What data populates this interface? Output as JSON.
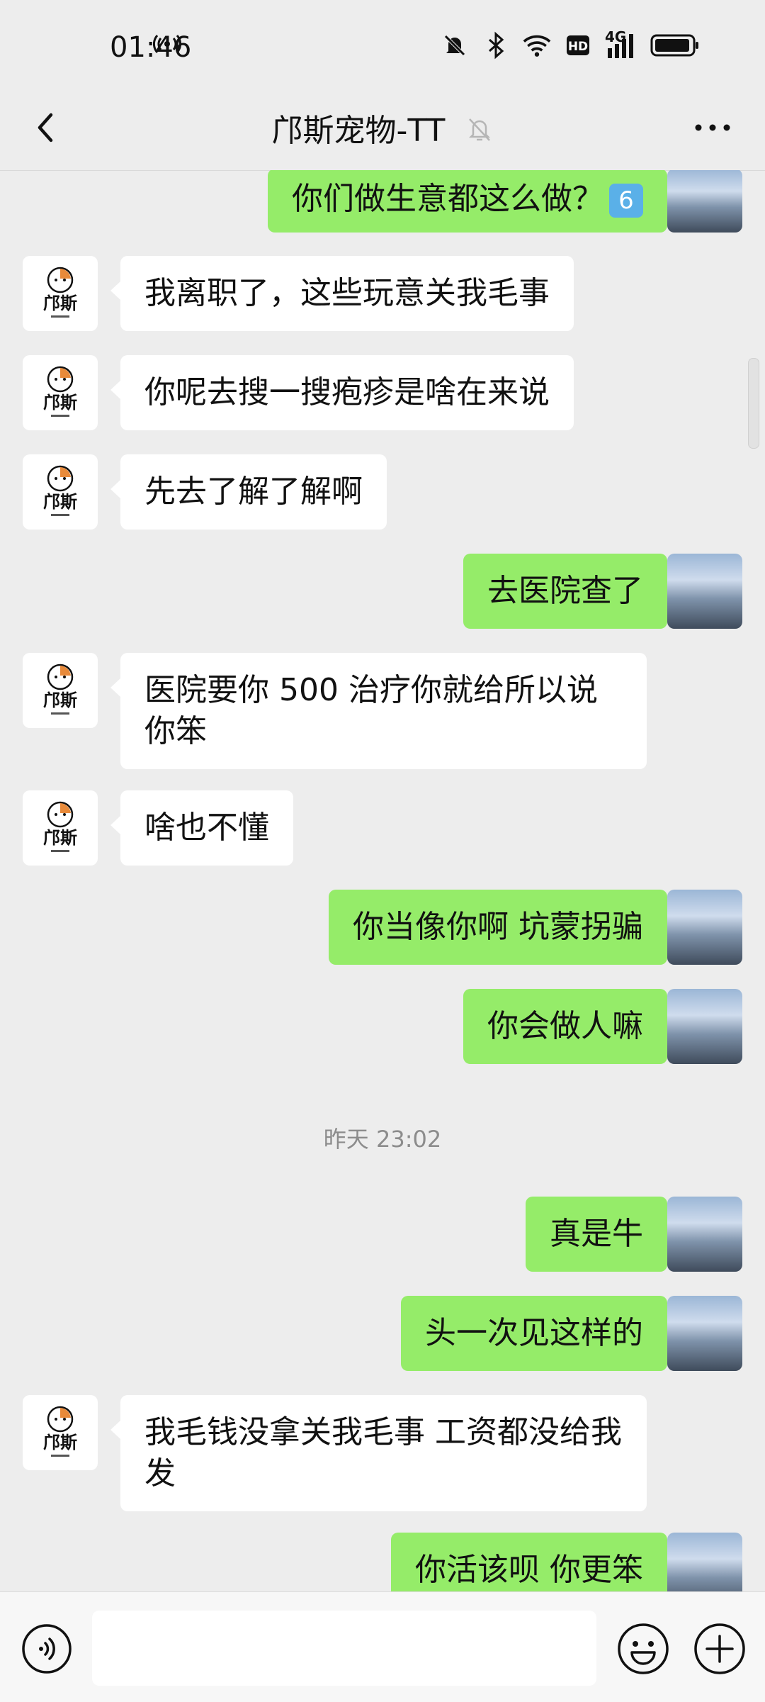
{
  "status": {
    "time": "01:46",
    "network": "4G"
  },
  "header": {
    "title": "邝斯宠物-TT"
  },
  "contact_logo_text": "邝斯",
  "messages": [
    {
      "side": "right",
      "text": "你们做生意都这么做？",
      "emoji": "6"
    },
    {
      "side": "left",
      "text": "我离职了，这些玩意关我毛事"
    },
    {
      "side": "left",
      "text": "你呢去搜一搜疱疹是啥在来说"
    },
    {
      "side": "left",
      "text": "先去了解了解啊"
    },
    {
      "side": "right",
      "text": "去医院查了"
    },
    {
      "side": "left",
      "text": "医院要你 500 治疗你就给所以说你笨"
    },
    {
      "side": "left",
      "text": "啥也不懂"
    },
    {
      "side": "right",
      "text": "你当像你啊 坑蒙拐骗"
    },
    {
      "side": "right",
      "text": "你会做人嘛"
    },
    {
      "side": "right",
      "text": "真是牛"
    },
    {
      "side": "right",
      "text": "头一次见这样的"
    },
    {
      "side": "left",
      "text": "我毛钱没拿关我毛事 工资都没给我发"
    },
    {
      "side": "right",
      "text": "你活该呗 你更笨"
    }
  ],
  "timestamp": "昨天 23:02",
  "input": {
    "value": "",
    "placeholder": ""
  },
  "colors": {
    "background": "#ededed",
    "sent_bubble": "#95ec69",
    "received_bubble": "#ffffff"
  }
}
